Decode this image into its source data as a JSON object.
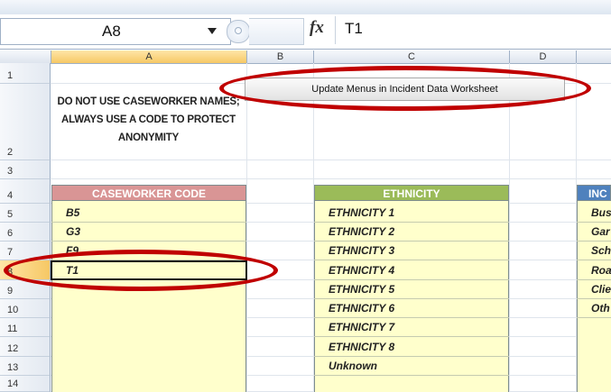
{
  "formula_bar": {
    "name_box": "A8",
    "fx_label": "fx",
    "formula_value": "T1"
  },
  "columns": [
    "A",
    "B",
    "C",
    "D"
  ],
  "rows": [
    "1",
    "2",
    "3",
    "4",
    "5",
    "6",
    "7",
    "8",
    "9",
    "10",
    "11",
    "12",
    "13",
    "14"
  ],
  "selected": {
    "cell": "A8",
    "row": "8",
    "column": "A"
  },
  "note_text": "DO NOT USE CASEWORKER NAMES; ALWAYS USE A CODE TO PROTECT ANONYMITY",
  "update_button_label": "Update Menus in Incident Data Worksheet",
  "tables": {
    "caseworker": {
      "header": "CASEWORKER CODE",
      "values": [
        "B5",
        "G3",
        "F9",
        "T1"
      ]
    },
    "ethnicity": {
      "header": "ETHNICITY",
      "values": [
        "ETHNICITY 1",
        "ETHNICITY 2",
        "ETHNICITY 3",
        "ETHNICITY 4",
        "ETHNICITY 5",
        "ETHNICITY 6",
        "ETHNICITY 7",
        "ETHNICITY 8",
        "Unknown"
      ]
    },
    "incident": {
      "header": "INC",
      "values": [
        "Bus",
        "Gar",
        "Sch",
        "Roa",
        "Clie",
        "Oth"
      ]
    }
  },
  "annotation_color": "#c00000"
}
